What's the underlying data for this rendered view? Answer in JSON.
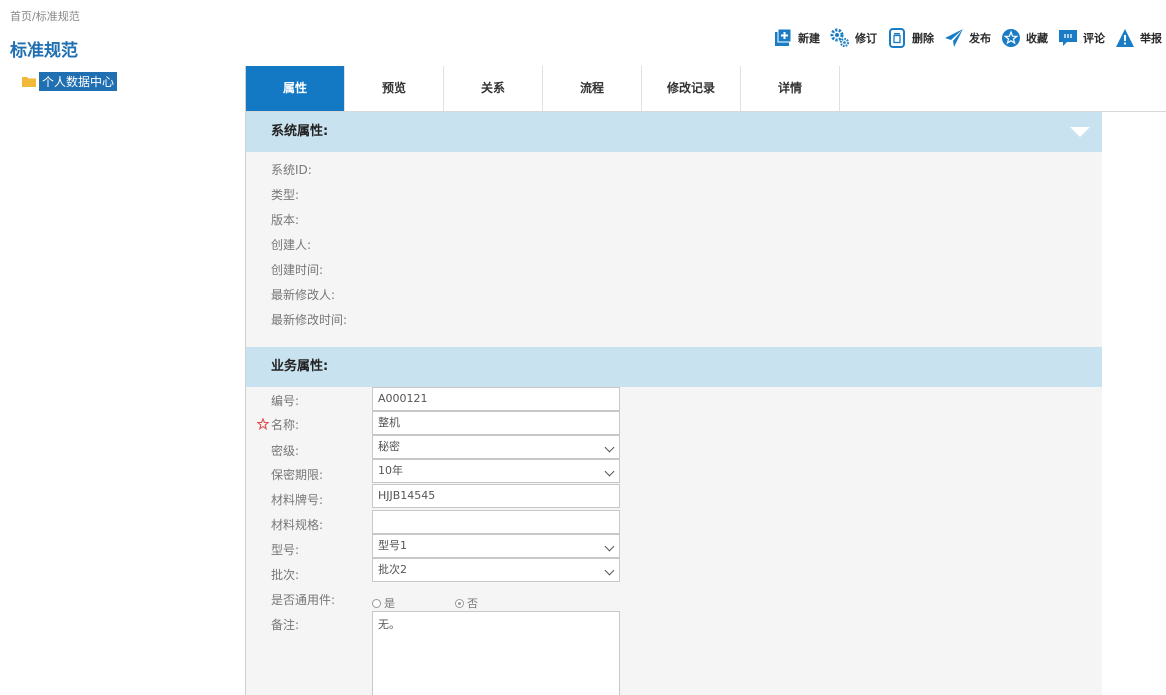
{
  "breadcrumb": {
    "home": "首页",
    "sep": " / ",
    "current": "标准规范"
  },
  "page_title": "标准规范",
  "toolbar": [
    {
      "id": "new",
      "label": "新建",
      "icon": "add-icon"
    },
    {
      "id": "revise",
      "label": "修订",
      "icon": "gears-icon"
    },
    {
      "id": "delete",
      "label": "删除",
      "icon": "trash-icon"
    },
    {
      "id": "publish",
      "label": "发布",
      "icon": "paper-plane-icon"
    },
    {
      "id": "favorite",
      "label": "收藏",
      "icon": "star-icon"
    },
    {
      "id": "comment",
      "label": "评论",
      "icon": "comment-icon"
    },
    {
      "id": "report",
      "label": "举报",
      "icon": "warning-icon"
    }
  ],
  "tree": {
    "root_label": "个人数据中心"
  },
  "tabs": [
    {
      "label": "属性",
      "active": true
    },
    {
      "label": "预览"
    },
    {
      "label": "关系"
    },
    {
      "label": "流程"
    },
    {
      "label": "修改记录"
    },
    {
      "label": "详情"
    }
  ],
  "system_section": {
    "title": "系统属性:",
    "fields": [
      "系统ID:",
      "类型:",
      "版本:",
      "创建人:",
      "创建时间:",
      "最新修改人:",
      "最新修改时间:"
    ]
  },
  "business_section": {
    "title": "业务属性:",
    "code": {
      "label": "编号:",
      "value": "A000121"
    },
    "name": {
      "label": "名称:",
      "value": "整机"
    },
    "secret_level": {
      "label": "密级:",
      "value": "秘密"
    },
    "secret_period": {
      "label": "保密期限:",
      "value": "10年"
    },
    "material_grade": {
      "label": "材料牌号:",
      "value": "HJJB14545"
    },
    "material_spec": {
      "label": "材料规格:",
      "value": ""
    },
    "model": {
      "label": "型号:",
      "value": "型号1"
    },
    "batch": {
      "label": "批次:",
      "value": "批次2"
    },
    "generic_part": {
      "label": "是否通用件:",
      "option_yes": "是",
      "option_no": "否",
      "selected": "否"
    },
    "remark": {
      "label": "备注:",
      "value": "无。"
    }
  },
  "colors": {
    "accent": "#1379c4",
    "section_bg": "#c9e2ef",
    "title": "#1f6fb2",
    "required": "#e05050"
  }
}
